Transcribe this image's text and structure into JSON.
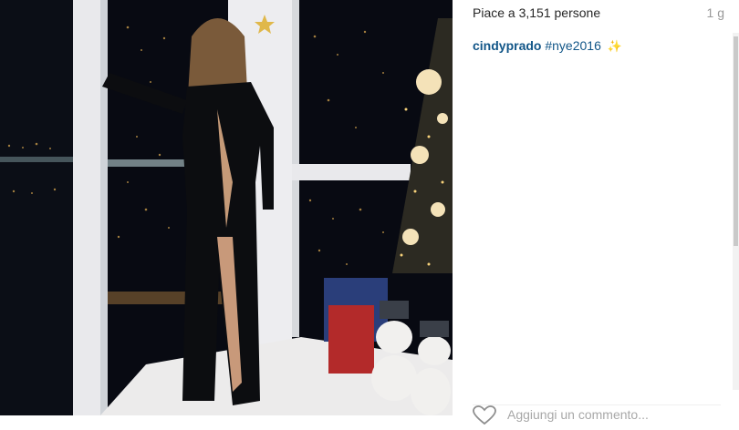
{
  "likes": {
    "text": "Piace a 3,151 persone"
  },
  "timestamp": "1 g",
  "caption": {
    "username": "cindyprado",
    "hashtag": "#nye2016",
    "emoji": "✨"
  },
  "comment": {
    "placeholder": "Aggiungi un commento..."
  },
  "icons": {
    "like": "heart-icon",
    "sparkle": "sparkles-icon"
  },
  "colors": {
    "link": "#125688",
    "muted": "#999999",
    "text": "#262626"
  }
}
